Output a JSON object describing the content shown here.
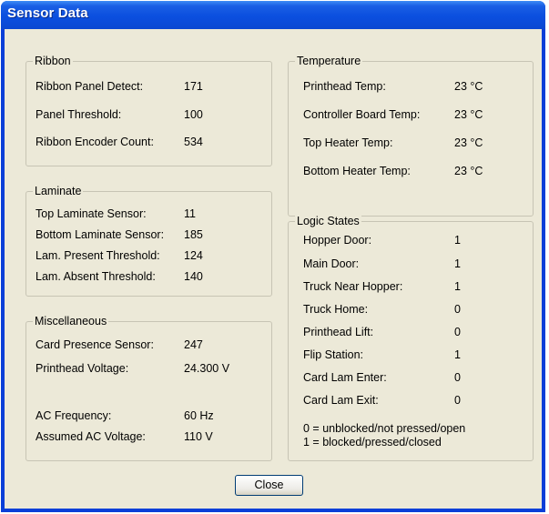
{
  "window": {
    "title": "Sensor Data"
  },
  "ribbon": {
    "legend": "Ribbon",
    "rows": [
      {
        "label": "Ribbon Panel Detect:",
        "value": "171"
      },
      {
        "label": "Panel Threshold:",
        "value": "100"
      },
      {
        "label": "Ribbon Encoder Count:",
        "value": "534"
      }
    ]
  },
  "laminate": {
    "legend": "Laminate",
    "rows": [
      {
        "label": "Top Laminate Sensor:",
        "value": "11"
      },
      {
        "label": "Bottom Laminate Sensor:",
        "value": "185"
      },
      {
        "label": "Lam. Present Threshold:",
        "value": "124"
      },
      {
        "label": "Lam. Absent Threshold:",
        "value": "140"
      }
    ]
  },
  "misc": {
    "legend": "Miscellaneous",
    "rows": [
      {
        "label": "Card Presence Sensor:",
        "value": "247"
      },
      {
        "label": "Printhead Voltage:",
        "value": "24.300 V"
      },
      {
        "label": "AC Frequency:",
        "value": "60 Hz"
      },
      {
        "label": "Assumed AC Voltage:",
        "value": "110 V"
      }
    ]
  },
  "temperature": {
    "legend": "Temperature",
    "rows": [
      {
        "label": "Printhead Temp:",
        "value": "23 °C"
      },
      {
        "label": "Controller Board Temp:",
        "value": "23 °C"
      },
      {
        "label": "Top Heater Temp:",
        "value": "23 °C"
      },
      {
        "label": "Bottom Heater Temp:",
        "value": "23 °C"
      }
    ]
  },
  "logic": {
    "legend": "Logic States",
    "rows": [
      {
        "label": "Hopper Door:",
        "value": "1"
      },
      {
        "label": "Main Door:",
        "value": "1"
      },
      {
        "label": "Truck Near Hopper:",
        "value": "1"
      },
      {
        "label": "Truck Home:",
        "value": "0"
      },
      {
        "label": "Printhead Lift:",
        "value": "0"
      },
      {
        "label": "Flip Station:",
        "value": "1"
      },
      {
        "label": "Card Lam Enter:",
        "value": "0"
      },
      {
        "label": "Card Lam Exit:",
        "value": "0"
      }
    ],
    "note_line1": "0 = unblocked/not pressed/open",
    "note_line2": "1 = blocked/pressed/closed"
  },
  "buttons": {
    "close": "Close"
  }
}
